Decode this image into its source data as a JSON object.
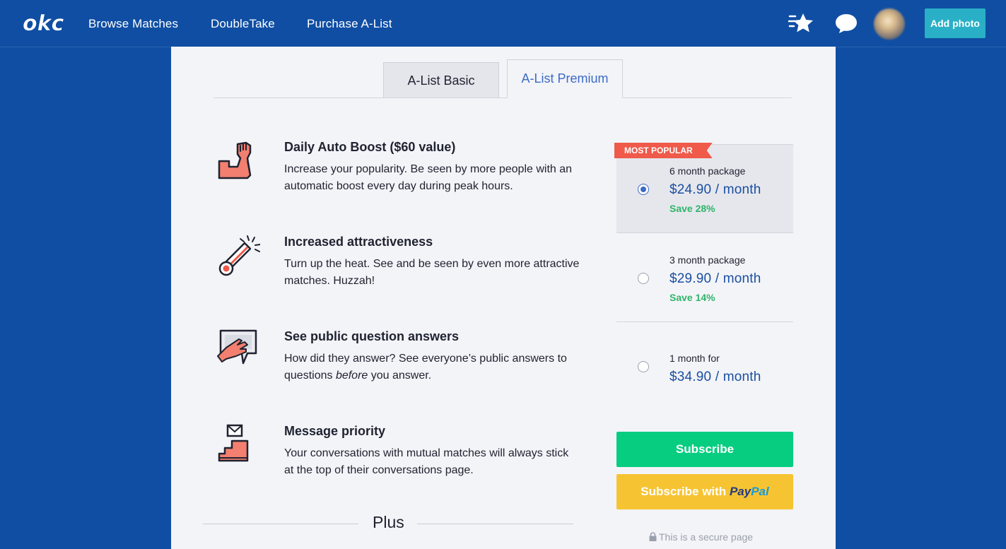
{
  "nav": {
    "logo_text": "okc",
    "links": [
      "Browse Matches",
      "DoubleTake",
      "Purchase A-List"
    ],
    "icons": [
      "star-icon",
      "chat-bubble-icon"
    ],
    "add_photo_label": "Add photo"
  },
  "tabs": [
    {
      "label": "A-List Basic",
      "active": false
    },
    {
      "label": "A-List Premium",
      "active": true
    }
  ],
  "features": [
    {
      "icon": "flexed-arm-icon",
      "title": "Daily Auto Boost ($60 value)",
      "desc": "Increase your popularity. Be seen by more people with an automatic boost every day during peak hours."
    },
    {
      "icon": "thermometer-icon",
      "title": "Increased attractiveness",
      "desc": "Turn up the heat. See and be seen by even more attractive matches. Huzzah!"
    },
    {
      "icon": "hand-speech-bubble-icon",
      "title": "See public question answers",
      "desc_before": "How did they answer? See everyone’s public answers to questions ",
      "desc_em": "before",
      "desc_after": " you answer."
    },
    {
      "icon": "message-stairs-icon",
      "title": "Message priority",
      "desc": "Your conversations with mutual matches will always stick at the top of their conversations page."
    }
  ],
  "pricing": {
    "badge": "MOST POPULAR",
    "plans": [
      {
        "label": "6 month package",
        "price": "$24.90 / month",
        "save": "Save 28%",
        "selected": true
      },
      {
        "label": "3 month package",
        "price": "$29.90 / month",
        "save": "Save 14%",
        "selected": false
      },
      {
        "label": "1 month for",
        "price": "$34.90 / month",
        "save": "",
        "selected": false
      }
    ],
    "subscribe_label": "Subscribe",
    "subscribe_with_label": "Subscribe with",
    "paypal_a": "Pay",
    "paypal_b": "Pal",
    "secure_text": "This is a secure page"
  },
  "plus_label": "Plus",
  "colors": {
    "brand_blue": "#0f4ea3",
    "accent_teal": "#2ab0c6",
    "subscribe_green": "#06cd80",
    "paypal_yellow": "#f6c433",
    "ribbon_red": "#ef5a4a",
    "save_green": "#2fb46a",
    "price_blue": "#1a4fa0"
  }
}
